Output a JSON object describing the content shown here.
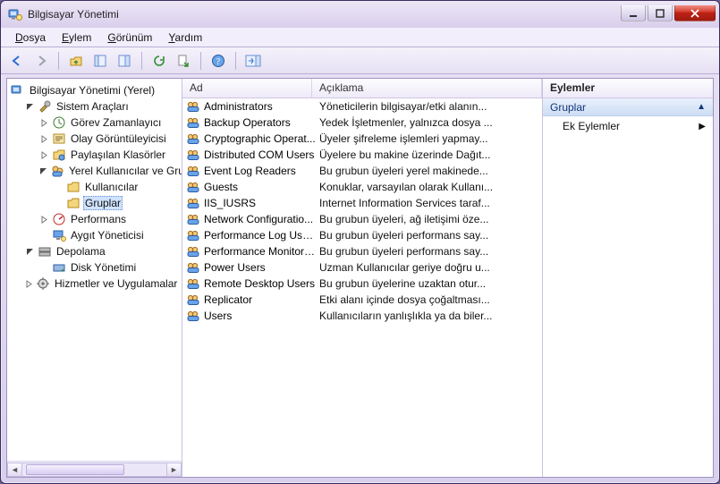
{
  "window": {
    "title": "Bilgisayar Yönetimi"
  },
  "menu": {
    "file": {
      "label": "Dosya",
      "underlined": "D"
    },
    "action": {
      "label": "Eylem",
      "underlined": "E"
    },
    "view": {
      "label": "Görünüm",
      "underlined": "G"
    },
    "help": {
      "label": "Yardım",
      "underlined": "Y"
    }
  },
  "tree": {
    "root": "Bilgisayar Yönetimi (Yerel)",
    "system_tools": "Sistem Araçları",
    "task_scheduler": "Görev Zamanlayıcı",
    "event_viewer": "Olay Görüntüleyicisi",
    "shared_folders": "Paylaşılan Klasörler",
    "local_users_groups": "Yerel Kullanıcılar ve Gruplar",
    "users": "Kullanıcılar",
    "groups": "Gruplar",
    "performance": "Performans",
    "device_manager": "Aygıt Yöneticisi",
    "storage": "Depolama",
    "disk_management": "Disk Yönetimi",
    "services_apps": "Hizmetler ve Uygulamalar"
  },
  "list": {
    "col_name": "Ad",
    "col_desc": "Açıklama",
    "rows": [
      {
        "name": "Administrators",
        "desc": "Yöneticilerin bilgisayar/etki alanın..."
      },
      {
        "name": "Backup Operators",
        "desc": "Yedek İşletmenler, yalnızca dosya ..."
      },
      {
        "name": "Cryptographic Operat...",
        "desc": "Üyeler şifreleme işlemleri yapmay..."
      },
      {
        "name": "Distributed COM Users",
        "desc": "Üyelere bu makine üzerinde Dağıt..."
      },
      {
        "name": "Event Log Readers",
        "desc": "Bu grubun üyeleri yerel makinede..."
      },
      {
        "name": "Guests",
        "desc": "Konuklar, varsayılan olarak Kullanı..."
      },
      {
        "name": "IIS_IUSRS",
        "desc": "Internet Information Services taraf..."
      },
      {
        "name": "Network Configuratio...",
        "desc": "Bu grubun üyeleri, ağ iletişimi öze..."
      },
      {
        "name": "Performance Log Users",
        "desc": "Bu grubun üyeleri performans say..."
      },
      {
        "name": "Performance Monitor ...",
        "desc": "Bu grubun üyeleri performans say..."
      },
      {
        "name": "Power Users",
        "desc": "Uzman Kullanıcılar geriye doğru u..."
      },
      {
        "name": "Remote Desktop Users",
        "desc": "Bu grubun üyelerine uzaktan otur..."
      },
      {
        "name": "Replicator",
        "desc": "Etki alanı içinde dosya çoğaltması..."
      },
      {
        "name": "Users",
        "desc": "Kullanıcıların yanlışlıkla ya da biler..."
      }
    ]
  },
  "actions": {
    "header": "Eylemler",
    "section": "Gruplar",
    "more": "Ek Eylemler"
  }
}
